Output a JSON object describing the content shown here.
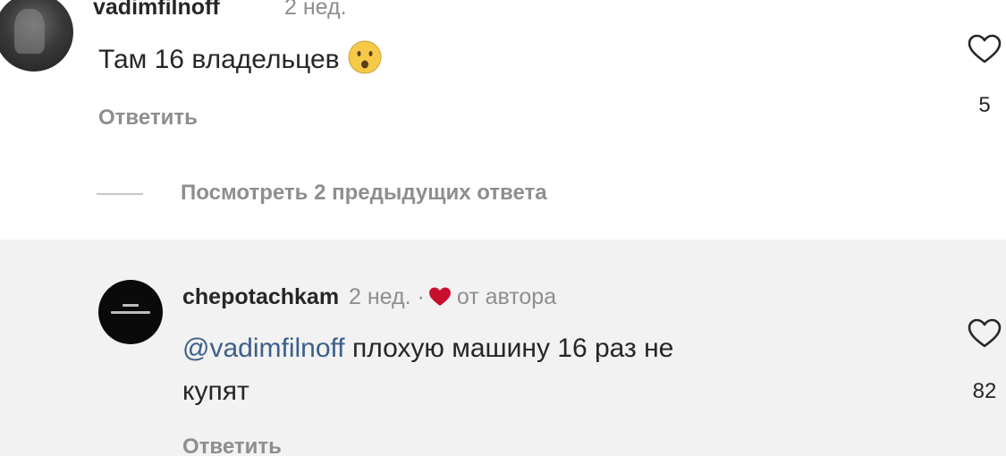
{
  "comments": [
    {
      "username": "vadimfilnoff",
      "time": "2 нед.",
      "text": "Там 16 владельцев",
      "emoji": "hushed-face-emoji",
      "reply_label": "Ответить",
      "likes": "5"
    },
    {
      "username": "chepotachkam",
      "time": "2 нед.",
      "separator": "·",
      "author_badge": "от автора",
      "mention": "@vadimfilnoff",
      "text_line1": " плохую машину 16 раз не",
      "text_line2": "купят",
      "reply_label": "Ответить",
      "likes": "82"
    }
  ],
  "view_replies_label": "Посмотреть 2 предыдущих ответа",
  "colors": {
    "text": "#262626",
    "muted": "#8e8e8e",
    "mention": "#3b5f8a",
    "heart": "#c8102e",
    "highlight_bg": "#f2f2f2"
  },
  "icons": {
    "like": "heart-outline-icon",
    "author_like": "heart-filled-icon"
  }
}
